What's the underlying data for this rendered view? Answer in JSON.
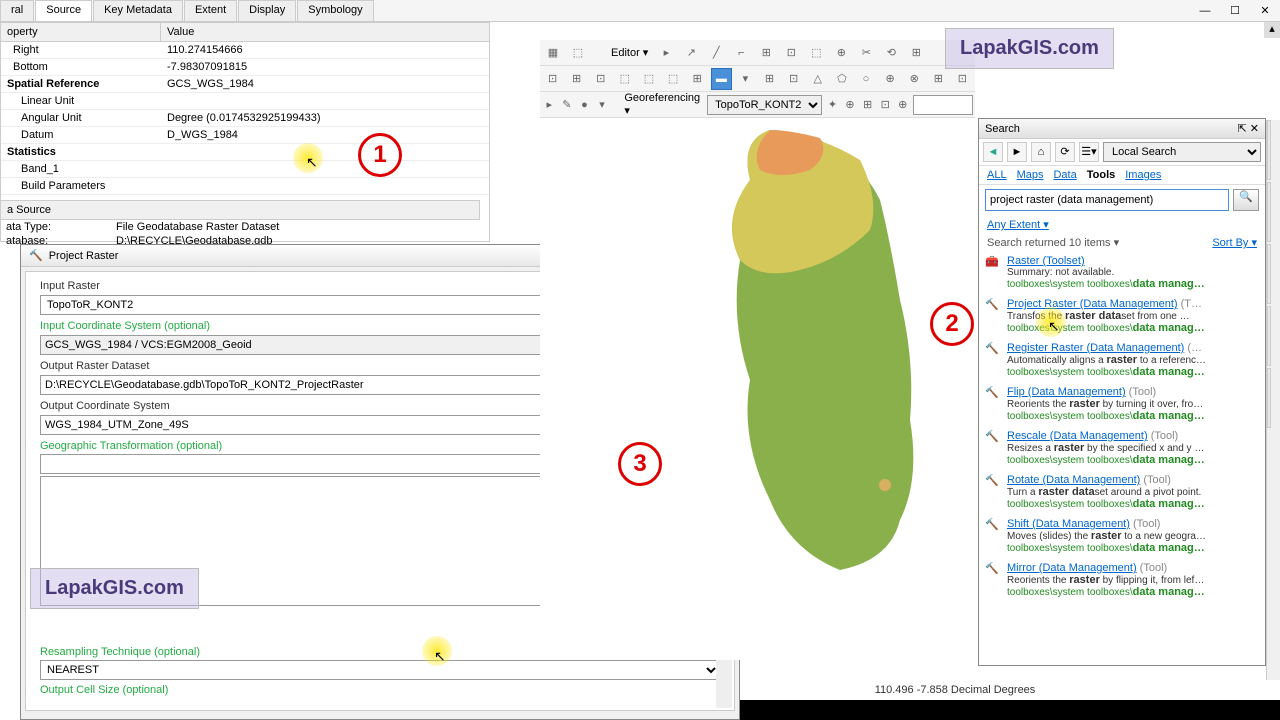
{
  "tabs": [
    "ral",
    "Source",
    "Key Metadata",
    "Extent",
    "Display",
    "Symbology"
  ],
  "prop_header": {
    "k": "operty",
    "v": "Value"
  },
  "props": [
    {
      "k": "Right",
      "v": "110.274154666",
      "cls": ""
    },
    {
      "k": "Bottom",
      "v": "-7.98307091815",
      "cls": ""
    },
    {
      "k": "Spatial Reference",
      "v": "GCS_WGS_1984",
      "cls": "bold"
    },
    {
      "k": "Linear Unit",
      "v": "",
      "cls": "indent"
    },
    {
      "k": "Angular Unit",
      "v": "Degree (0.0174532925199433)",
      "cls": "indent"
    },
    {
      "k": "Datum",
      "v": "D_WGS_1984",
      "cls": "indent"
    },
    {
      "k": "Statistics",
      "v": "",
      "cls": "bold"
    },
    {
      "k": "Band_1",
      "v": "",
      "cls": "indent"
    },
    {
      "k": "Build Parameters",
      "v": "",
      "cls": "indent"
    }
  ],
  "ds_head": "a Source",
  "ds_rows": [
    {
      "k": "ata Type:",
      "v": "File Geodatabase Raster Dataset"
    },
    {
      "k": "atabase:",
      "v": "D:\\RECYCLE\\Geodatabase.gdb"
    }
  ],
  "tool": {
    "title": "Project Raster",
    "fields": {
      "input_raster": {
        "label": "Input Raster",
        "value": "TopoToR_KONT2"
      },
      "input_cs": {
        "label": "Input Coordinate System (optional)",
        "value": "GCS_WGS_1984 / VCS:EGM2008_Geoid"
      },
      "output_ds": {
        "label": "Output Raster Dataset",
        "value": "D:\\RECYCLE\\Geodatabase.gdb\\TopoToR_KONT2_ProjectRaster"
      },
      "output_cs": {
        "label": "Output Coordinate System",
        "value": "WGS_1984_UTM_Zone_49S"
      },
      "geo_trans": {
        "label": "Geographic Transformation (optional)",
        "value": ""
      },
      "resample": {
        "label": "Resampling Technique (optional)",
        "value": "NEAREST"
      },
      "cellsize": {
        "label": "Output Cell Size (optional)",
        "value": ""
      }
    }
  },
  "toolbar": {
    "editor": "Editor ▾",
    "georef": "Georeferencing ▾",
    "layer": "TopoToR_KONT2"
  },
  "search": {
    "title": "Search",
    "local": "Local Search",
    "tabs": [
      "ALL",
      "Maps",
      "Data",
      "Tools",
      "Images"
    ],
    "active_tab": "Tools",
    "query": "project raster (data management)",
    "extent": "Any Extent ▾",
    "meta": "Search returned 10 items ▾",
    "sort": "Sort By ▾",
    "results": [
      {
        "title": "Raster",
        "paren": "(Toolset)",
        "sum": "Summary: not available.",
        "path": "toolboxes\\system toolboxes\\",
        "pathb": "data manag…",
        "icon": "toolbox"
      },
      {
        "title": "Project Raster",
        "paren": "(Data Management)",
        "tool": "(T…",
        "sum_pre": "Transfo",
        "sum_mid": "s the ",
        "sum_b": "raster data",
        "sum_post": "set from one …",
        "path": "toolboxes\\system toolboxes\\",
        "pathb": "data manag…",
        "icon": "hammer"
      },
      {
        "title": "Register Raster",
        "paren": "(Data Management)",
        "tool": "(…",
        "sum_pre": "Automatically aligns a ",
        "sum_b": "raster",
        "sum_post": " to a referenc…",
        "path": "toolboxes\\system toolboxes\\",
        "pathb": "data manag…",
        "icon": "hammer"
      },
      {
        "title": "Flip",
        "paren": "(Data Management)",
        "tool": "(Tool)",
        "sum_pre": "Reorients the ",
        "sum_b": "raster",
        "sum_post": " by turning it over, fro…",
        "path": "toolboxes\\system toolboxes\\",
        "pathb": "data manag…",
        "icon": "hammer"
      },
      {
        "title": "Rescale",
        "paren": "(Data Management)",
        "tool": "(Tool)",
        "sum_pre": "Resizes a ",
        "sum_b": "raster",
        "sum_post": " by the specified x and y …",
        "path": "toolboxes\\system toolboxes\\",
        "pathb": "data manag…",
        "icon": "hammer"
      },
      {
        "title": "Rotate",
        "paren": "(Data Management)",
        "tool": "(Tool)",
        "sum_pre": "Turn a ",
        "sum_b": "raster data",
        "sum_post": "set around a pivot point.",
        "path": "toolboxes\\system toolboxes\\",
        "pathb": "data manag…",
        "icon": "hammer"
      },
      {
        "title": "Shift",
        "paren": "(Data Management)",
        "tool": "(Tool)",
        "sum_pre": "Moves (slides) the ",
        "sum_b": "raster",
        "sum_post": " to a new geogra…",
        "path": "toolboxes\\system toolboxes\\",
        "pathb": "data manag…",
        "icon": "hammer"
      },
      {
        "title": "Mirror",
        "paren": "(Data Management)",
        "tool": "(Tool)",
        "sum_pre": "Reorients the ",
        "sum_b": "raster",
        "sum_post": " by flipping it, from lef…",
        "path": "toolboxes\\system toolboxes\\",
        "pathb": "data manag…",
        "icon": "hammer"
      }
    ]
  },
  "coords": "110.496  -7.858 Decimal Degrees",
  "watermark": "LapakGIS.com",
  "circles": {
    "c1": "1",
    "c2": "2",
    "c3": "3"
  },
  "redline": "1"
}
